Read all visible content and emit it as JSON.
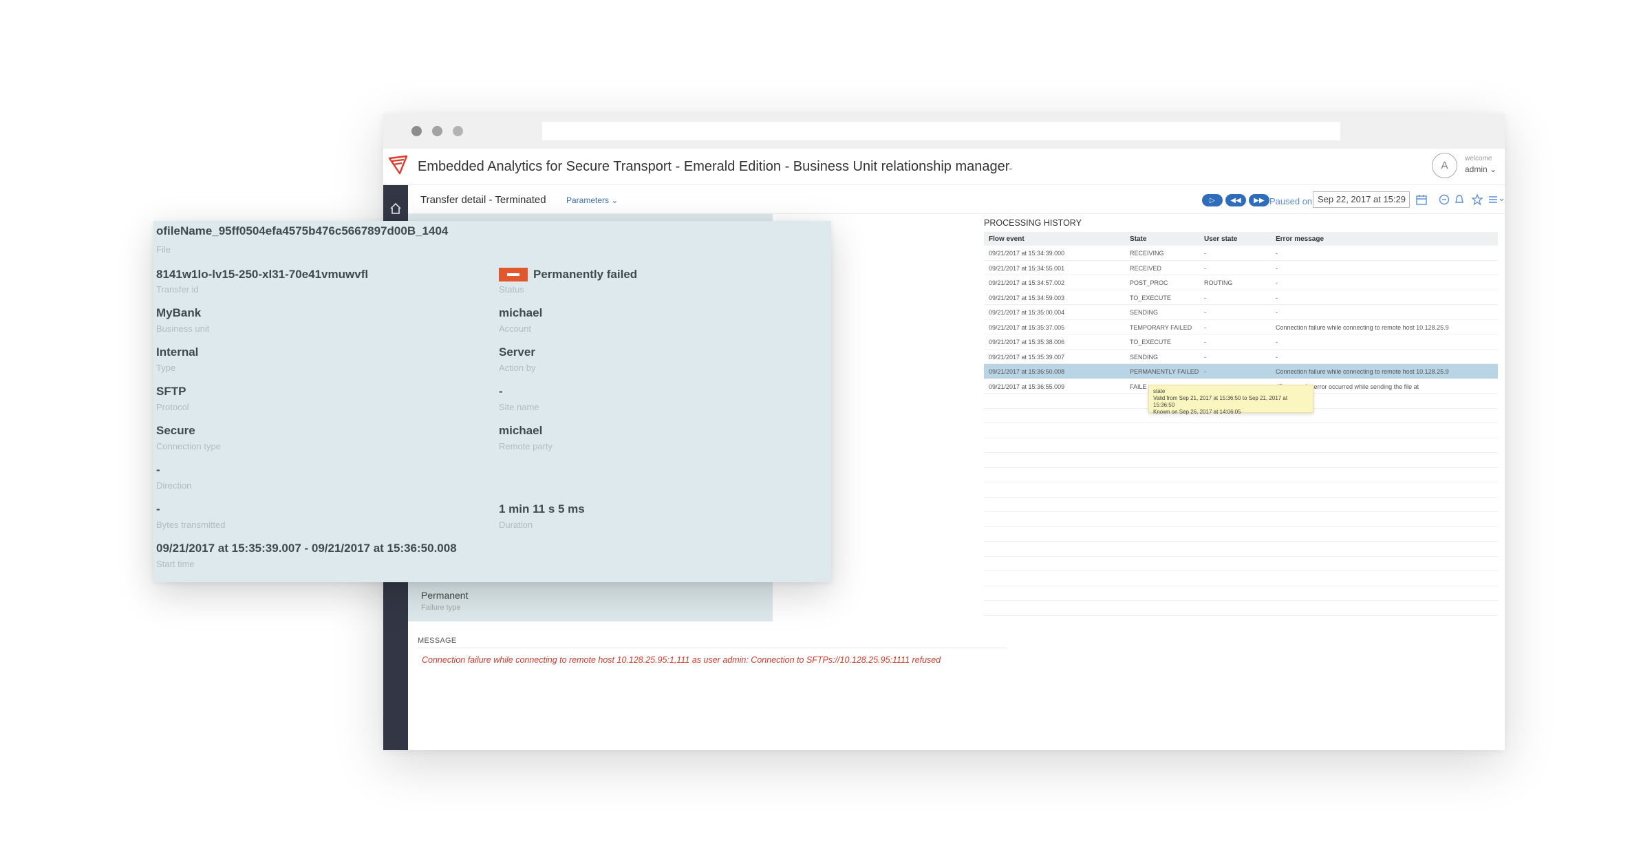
{
  "app": {
    "title": "Embedded Analytics for Secure Transport - Emerald Edition - Business Unit relationship manager",
    "title_caret": "⌄",
    "avatar_letter": "A",
    "welcome": "welcome",
    "user": "admin ⌄"
  },
  "toolbar": {
    "breadcrumb": "Transfer detail  - Terminated",
    "parameters": "Parameters ⌄",
    "play": "▷",
    "rewind": "◀◀",
    "forward": "▶▶",
    "paused_on": "Paused on",
    "date": "Sep 22, 2017 at 15:29",
    "icons": [
      "calendar-icon",
      "filter-icon",
      "bell-icon",
      "star-icon",
      "menu-icon"
    ]
  },
  "details": {
    "failure_type_value": "Permanent",
    "failure_type_label": "Failure type"
  },
  "message": {
    "heading": "MESSAGE",
    "text": "Connection failure while connecting to remote host 10.128.25.95:1,111 as user admin: Connection to SFTPs://10.128.25.95:1111 refused"
  },
  "history": {
    "title": "PROCESSING HISTORY",
    "headers": [
      "Flow event",
      "State",
      "User state",
      "Error message"
    ],
    "rows": [
      [
        "09/21/2017 at 15:34:39.000",
        "RECEIVING",
        "-",
        "-"
      ],
      [
        "09/21/2017 at 15:34:55.001",
        "RECEIVED",
        "-",
        "-"
      ],
      [
        "09/21/2017 at 15:34:57.002",
        "POST_PROC",
        "ROUTING",
        "-"
      ],
      [
        "09/21/2017 at 15:34:59.003",
        "TO_EXECUTE",
        "-",
        "-"
      ],
      [
        "09/21/2017 at 15:35:00.004",
        "SENDING",
        "-",
        "-"
      ],
      [
        "09/21/2017 at 15:35:37.005",
        "TEMPORARY FAILED",
        "-",
        "Connection failure while connecting to remote host 10.128.25.9"
      ],
      [
        "09/21/2017 at 15:35:38.006",
        "TO_EXECUTE",
        "-",
        "-"
      ],
      [
        "09/21/2017 at 15:35:39.007",
        "SENDING",
        "-",
        "-"
      ],
      [
        "09/21/2017 at 15:36:50.008",
        "PERMANENTLY FAILED",
        "-",
        "Connection failure while connecting to remote host 10.128.25.9"
      ],
      [
        "09/21/2017 at 15:36:55.009",
        "FAILE",
        "",
        "dPartner - An error occurred while sending the file at"
      ]
    ],
    "tooltip": {
      "title": "state",
      "line1": "Valid from Sep 21, 2017 at 15:36:50 to Sep 21, 2017 at 15:36:50",
      "line2": "Known on Sep 26, 2017 at 14:06:05"
    }
  },
  "overlay": {
    "file_value": "ofileName_95ff0504efa4575b476c5667897d00B_1404",
    "file_label": "File",
    "transfer_id_value": "8141w1lo-lv15-250-xl31-70e41vmuwvfl",
    "transfer_id_label": "Transfer id",
    "status_value": "Permanently failed",
    "status_label": "Status",
    "business_unit_value": "MyBank",
    "business_unit_label": "Business unit",
    "account_value": "michael",
    "account_label": "Account",
    "type_value": "Internal",
    "type_label": "Type",
    "action_by_value": "Server",
    "action_by_label": "Action by",
    "protocol_value": "SFTP",
    "protocol_label": "Protocol",
    "sit_value": "-",
    "sit_label": "Site name",
    "connection_type_value": "Secure",
    "connection_type_label": "Connection type",
    "remote_party_value": "michael",
    "remote_party_label": "Remote party",
    "direction_value": "-",
    "direction_label": "Direction",
    "bytes_value": "-",
    "bytes_label": "Bytes transmitted",
    "duration_value": "1 min 11 s 5 ms",
    "duration_label": "Duration",
    "start_time_value": "09/21/2017 at 15:35:39.007 - 09/21/2017 at 15:36:50.008",
    "start_time_label": "Start time"
  }
}
